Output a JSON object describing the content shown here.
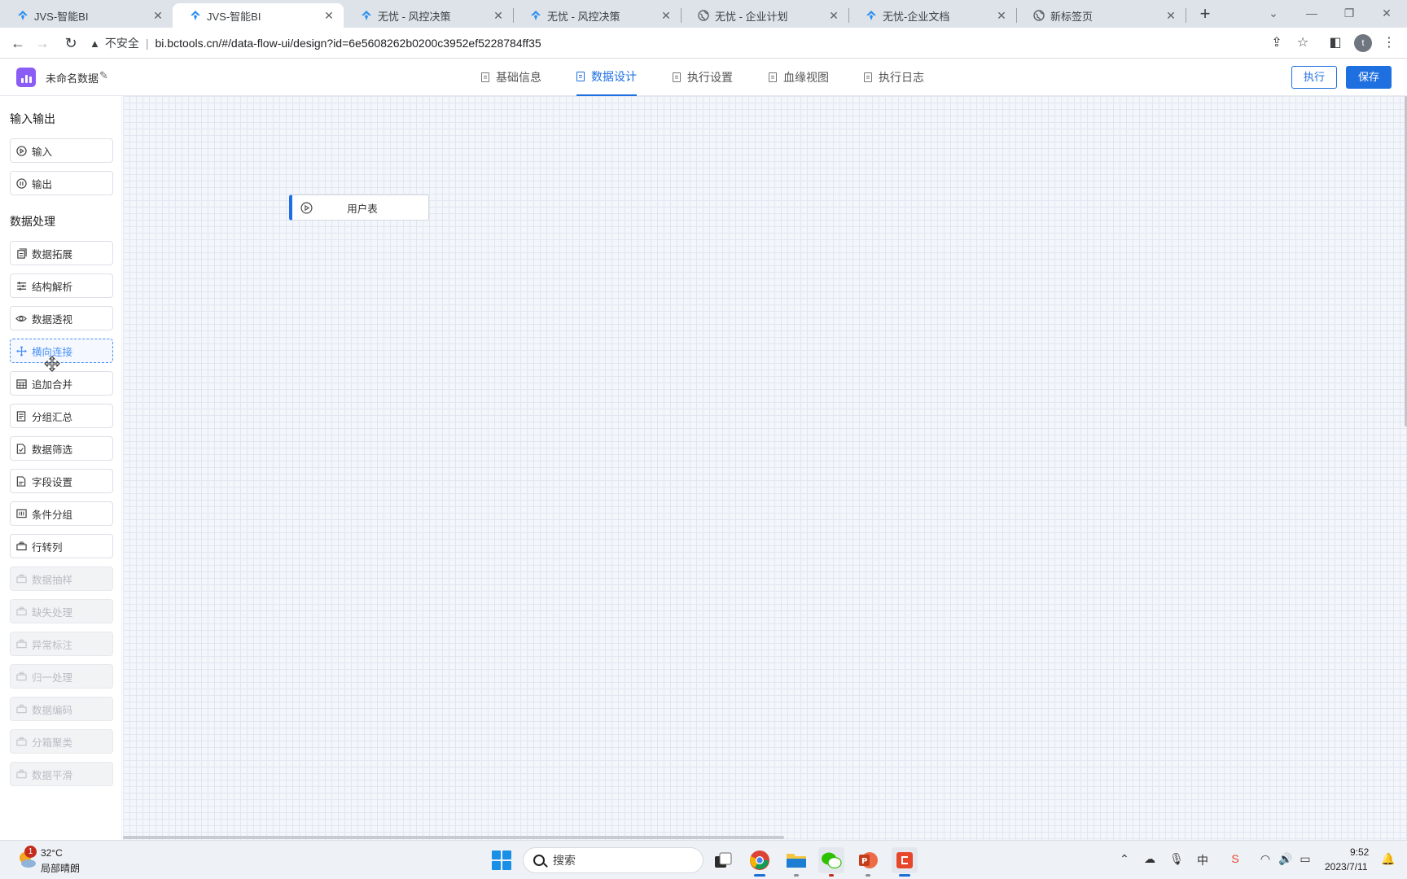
{
  "browser": {
    "tabs": [
      {
        "title": "JVS-智能BI",
        "icon": "jvs-icon"
      },
      {
        "title": "JVS-智能BI",
        "icon": "jvs-icon",
        "active": true
      },
      {
        "title": "无忧 - 风控决策",
        "icon": "jvs-icon"
      },
      {
        "title": "无忧 - 风控决策",
        "icon": "jvs-icon"
      },
      {
        "title": "无忧 - 企业计划",
        "icon": "globe-icon"
      },
      {
        "title": "无忧-企业文档",
        "icon": "jvs-icon"
      },
      {
        "title": "新标签页",
        "icon": "globe-icon"
      }
    ],
    "insecure_label": "不安全",
    "url": "bi.bctools.cn/#/data-flow-ui/design?id=6e5608262b0200c3952ef5228784ff35",
    "profile_initial": "t"
  },
  "app": {
    "name": "未命名数据",
    "tabs": [
      "基础信息",
      "数据设计",
      "执行设置",
      "血缘视图",
      "执行日志"
    ],
    "active_tab": "数据设计",
    "execute_label": "执行",
    "save_label": "保存",
    "accent_color": "#1e6fe0"
  },
  "sidebar": {
    "io_title": "输入输出",
    "io_items": [
      "输入",
      "输出"
    ],
    "processing_title": "数据处理",
    "processing_items": [
      {
        "label": "数据拓展",
        "icon": "expand-icon",
        "state": "enabled"
      },
      {
        "label": "结构解析",
        "icon": "sliders-icon",
        "state": "enabled"
      },
      {
        "label": "数据透视",
        "icon": "eye-icon",
        "state": "enabled"
      },
      {
        "label": "横向连接",
        "icon": "move-icon",
        "state": "dragging"
      },
      {
        "label": "追加合并",
        "icon": "calendar-icon",
        "state": "enabled"
      },
      {
        "label": "分组汇总",
        "icon": "list-icon",
        "state": "enabled"
      },
      {
        "label": "数据筛选",
        "icon": "filter-doc-icon",
        "state": "enabled"
      },
      {
        "label": "字段设置",
        "icon": "doc-icon",
        "state": "enabled"
      },
      {
        "label": "条件分组",
        "icon": "group-icon",
        "state": "enabled"
      },
      {
        "label": "行转列",
        "icon": "stack-icon",
        "state": "enabled"
      },
      {
        "label": "数据抽样",
        "icon": "stack-icon",
        "state": "disabled"
      },
      {
        "label": "缺失处理",
        "icon": "stack-icon",
        "state": "disabled"
      },
      {
        "label": "异常标注",
        "icon": "stack-icon",
        "state": "disabled"
      },
      {
        "label": "归一处理",
        "icon": "stack-icon",
        "state": "disabled"
      },
      {
        "label": "数据编码",
        "icon": "stack-icon",
        "state": "disabled"
      },
      {
        "label": "分箱聚类",
        "icon": "stack-icon",
        "state": "disabled"
      },
      {
        "label": "数据平滑",
        "icon": "stack-icon",
        "state": "disabled"
      }
    ]
  },
  "canvas": {
    "nodes": [
      {
        "label": "用户表",
        "icon": "play-circle-icon"
      }
    ]
  },
  "taskbar": {
    "temperature": "32°C",
    "weather": "局部晴朗",
    "notification_count": "1",
    "search_placeholder": "搜索",
    "ime": "中",
    "time": "9:52",
    "date": "2023/7/11"
  }
}
